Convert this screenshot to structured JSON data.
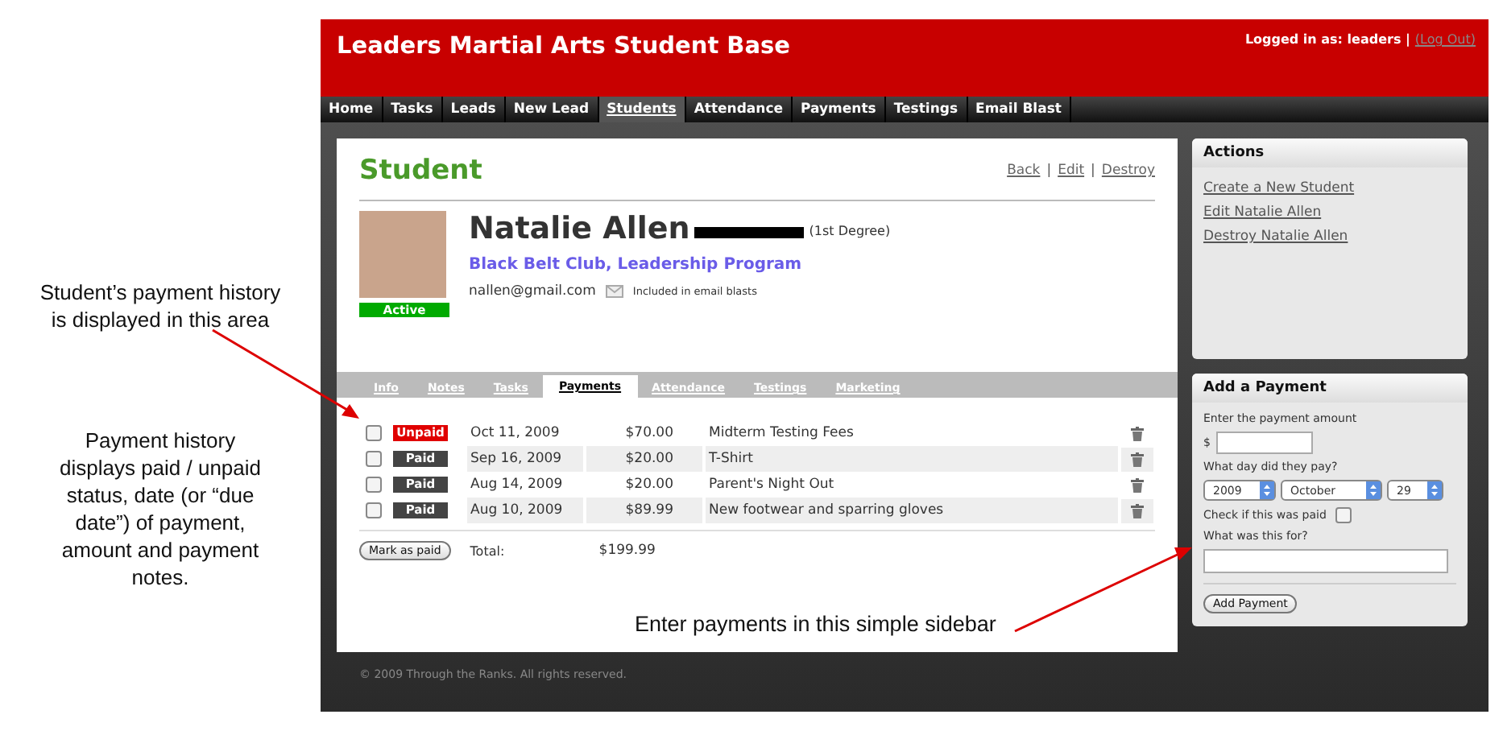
{
  "annotations": [
    {
      "text": "Student’s payment history is displayed in this area"
    },
    {
      "text": "Payment history displays paid / unpaid status, date (or “due date”) of payment, amount and payment notes."
    },
    {
      "text": "Enter payments in this simple sidebar"
    }
  ],
  "header": {
    "title": "Leaders Martial Arts Student Base",
    "login_text": "Logged in as: leaders |",
    "logout_link": "(Log Out)"
  },
  "nav": [
    {
      "label": "Home",
      "selected": false
    },
    {
      "label": "Tasks",
      "selected": false
    },
    {
      "label": "Leads",
      "selected": false
    },
    {
      "label": "New Lead",
      "selected": false
    },
    {
      "label": "Students",
      "selected": true
    },
    {
      "label": "Attendance",
      "selected": false
    },
    {
      "label": "Payments",
      "selected": false
    },
    {
      "label": "Testings",
      "selected": false
    },
    {
      "label": "Email Blast",
      "selected": false
    }
  ],
  "student": {
    "heading": "Student",
    "links": [
      "Back",
      "Edit",
      "Destroy"
    ],
    "link_separator": "|",
    "name": "Natalie Allen",
    "degree": "(1st Degree)",
    "programs": "Black Belt Club, Leadership Program",
    "email": "nallen@gmail.com",
    "email_note": "Included in email blasts",
    "status": "Active"
  },
  "tabs": [
    {
      "label": "Info",
      "selected": false
    },
    {
      "label": "Notes",
      "selected": false
    },
    {
      "label": "Tasks",
      "selected": false
    },
    {
      "label": "Payments",
      "selected": true
    },
    {
      "label": "Attendance",
      "selected": false
    },
    {
      "label": "Testings",
      "selected": false
    },
    {
      "label": "Marketing",
      "selected": false
    }
  ],
  "payments": [
    {
      "checked": false,
      "paid": false,
      "status": "Unpaid",
      "date": "Oct 11, 2009",
      "amount": "$70.00",
      "note": "Midterm Testing Fees"
    },
    {
      "checked": false,
      "paid": true,
      "status": "Paid",
      "date": "Sep 16, 2009",
      "amount": "$20.00",
      "note": "T-Shirt"
    },
    {
      "checked": false,
      "paid": true,
      "status": "Paid",
      "date": "Aug 14, 2009",
      "amount": "$20.00",
      "note": "Parent's Night Out"
    },
    {
      "checked": false,
      "paid": true,
      "status": "Paid",
      "date": "Aug 10, 2009",
      "amount": "$89.99",
      "note": "New footwear and sparring gloves"
    }
  ],
  "mark_paid_button": "Mark as paid",
  "total_label": "Total:",
  "total": "$199.99",
  "actions": {
    "title": "Actions",
    "links": [
      "Create a New Student",
      "Edit Natalie Allen",
      "Destroy Natalie Allen"
    ]
  },
  "add_payment": {
    "title": "Add a Payment",
    "amount_label": "Enter the payment amount",
    "currency": "$",
    "date_label": "What day did they pay?",
    "year": "2009",
    "month": "October",
    "day": "29",
    "paid_label": "Check if this was paid",
    "paid_checked": false,
    "for_label": "What was this for?",
    "button": "Add Payment"
  },
  "footer": "© 2009 Through the Ranks. All rights reserved."
}
